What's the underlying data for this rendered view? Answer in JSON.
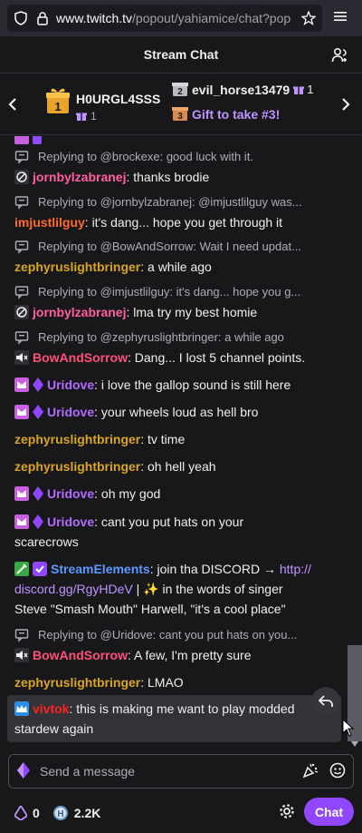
{
  "browser": {
    "url_domain": "www.twitch.tv",
    "url_path": "/popout/yahiamice/chat?pop"
  },
  "header": {
    "title": "Stream Chat"
  },
  "leaderboard": {
    "first": {
      "name": "H0URGL4SSS",
      "rank": "1",
      "gifts": "1"
    },
    "second": {
      "name": "evil_horse13479",
      "gifts": "1"
    },
    "cta": "Gift to take #3!"
  },
  "messages": [
    {
      "reply": "Replying to @brockexe: good luck with it.",
      "user": "jornbylzabranej",
      "color": "#ff5ea0",
      "text": ": thanks brodie"
    },
    {
      "reply": "Replying to @jornbylzabranej: @imjustlilguy was...",
      "user": "imjustlilguy",
      "color": "#ff6b2b",
      "text": ": it's dang... hope you get through it"
    },
    {
      "reply": "Replying to @BowAndSorrow: Wait I need updat...",
      "user": "zephyruslightbringer",
      "color": "#daa520",
      "text": ": a while ago"
    },
    {
      "reply": "Replying to @imjustlilguy: it's dang... hope you g...",
      "user": "jornbylzabranej",
      "color": "#ff5ea0",
      "text": ": lma try my best homie"
    },
    {
      "reply": "Replying to @zephyruslightbringer: a while ago",
      "user": "BowAndSorrow",
      "color": "#ff4f76",
      "text": ": Dang... I lost 5 channel points."
    },
    {
      "user": "Uridove",
      "color": "#b36bff",
      "text": ": i love the gallop sound is still here"
    },
    {
      "user": "Uridove",
      "color": "#b36bff",
      "text": ": your wheels loud as hell bro"
    },
    {
      "user": "zephyruslightbringer",
      "color": "#daa520",
      "text": ": tv time"
    },
    {
      "user": "zephyruslightbringer",
      "color": "#daa520",
      "text": ": oh hell yeah"
    },
    {
      "user": "Uridove",
      "color": "#b36bff",
      "text": ": oh my god"
    },
    {
      "user": "Uridove",
      "color": "#b36bff",
      "text": ": cant you put hats on your",
      "text2": "scarecrows"
    },
    {
      "user": "StreamElements",
      "color": "#5b99ff",
      "text": ": join tha DISCORD → ",
      "link1": "http://",
      "link2": "discord.gg/RgyHDeV",
      "text3": " | ✨ in the words of singer",
      "text4": "Steve \"Smash Mouth\" Harwell, \"it's a cool place\""
    },
    {
      "reply": "Replying to @Uridove: cant you put hats on you...",
      "user": "BowAndSorrow",
      "color": "#ff4f76",
      "text": ": A few, I'm pretty sure"
    },
    {
      "user": "zephyruslightbringer",
      "color": "#daa520",
      "text": ": LMAO"
    },
    {
      "user": "vivtok",
      "color": "#ff2222",
      "text": ": this is making me want to play modded",
      "text2": "stardew again"
    }
  ],
  "input": {
    "placeholder": "Send a message"
  },
  "footer": {
    "points": "0",
    "coins": "2.2K",
    "chat_button": "Chat"
  }
}
